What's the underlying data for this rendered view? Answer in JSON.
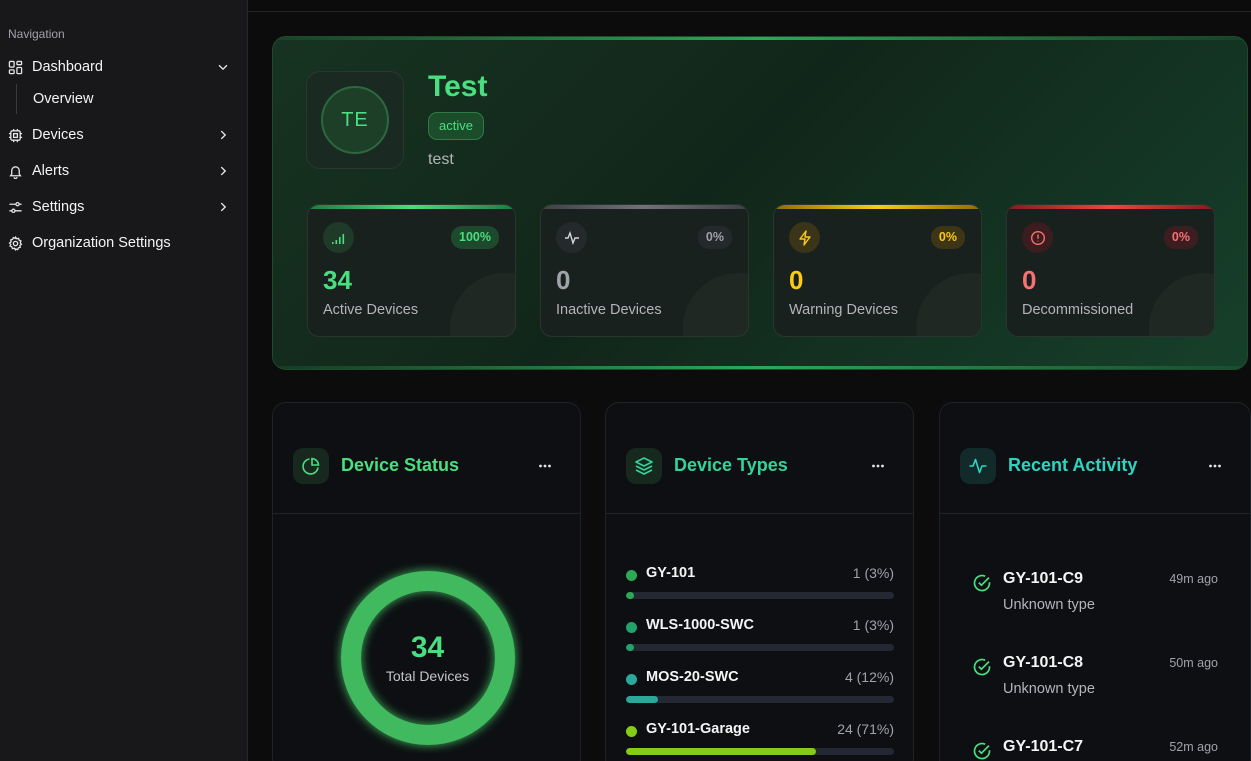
{
  "sidebar": {
    "section_label": "Navigation",
    "items": [
      {
        "label": "Dashboard",
        "icon": "dashboard-icon",
        "chevron": "chevron-down-icon"
      },
      {
        "label": "Overview"
      },
      {
        "label": "Devices",
        "icon": "cpu-icon",
        "chevron": "chevron-right-icon"
      },
      {
        "label": "Alerts",
        "icon": "bell-icon",
        "chevron": "chevron-right-icon"
      },
      {
        "label": "Settings",
        "icon": "sliders-icon",
        "chevron": "chevron-right-icon"
      },
      {
        "label": "Organization Settings",
        "icon": "gear-icon"
      }
    ]
  },
  "org": {
    "initials": "TE",
    "name": "Test",
    "status": "active",
    "description": "test"
  },
  "stats": [
    {
      "value": "34",
      "label": "Active Devices",
      "percent": "100%",
      "color": "#4ade80",
      "icon": "signal-icon"
    },
    {
      "value": "0",
      "label": "Inactive Devices",
      "percent": "0%",
      "color": "#a1a1aa",
      "icon": "activity-icon"
    },
    {
      "value": "0",
      "label": "Warning Devices",
      "percent": "0%",
      "color": "#facc15",
      "icon": "zap-icon"
    },
    {
      "value": "0",
      "label": "Decommissioned",
      "percent": "0%",
      "color": "#f87171",
      "icon": "alert-circle-icon"
    }
  ],
  "device_status": {
    "title": "Device Status",
    "total": "34",
    "total_label": "Total Devices"
  },
  "device_types": {
    "title": "Device Types",
    "items": [
      {
        "name": "GY-101",
        "count": "1 (3%)",
        "fraction": 0.03,
        "color": "#2ea857"
      },
      {
        "name": "WLS-1000-SWC",
        "count": "1 (3%)",
        "fraction": 0.03,
        "color": "#22a36a"
      },
      {
        "name": "MOS-20-SWC",
        "count": "4 (12%)",
        "fraction": 0.12,
        "color": "#2aa89a"
      },
      {
        "name": "GY-101-Garage",
        "count": "24 (71%)",
        "fraction": 0.71,
        "color": "#84cc16"
      }
    ]
  },
  "recent_activity": {
    "title": "Recent Activity",
    "items": [
      {
        "name": "GY-101-C9",
        "time": "49m ago",
        "type": "Unknown type"
      },
      {
        "name": "GY-101-C8",
        "time": "50m ago",
        "type": "Unknown type"
      },
      {
        "name": "GY-101-C7",
        "time": "52m ago",
        "type": ""
      }
    ]
  },
  "colors": {
    "accent": "#4ade80",
    "teal": "#2dd4bf"
  }
}
